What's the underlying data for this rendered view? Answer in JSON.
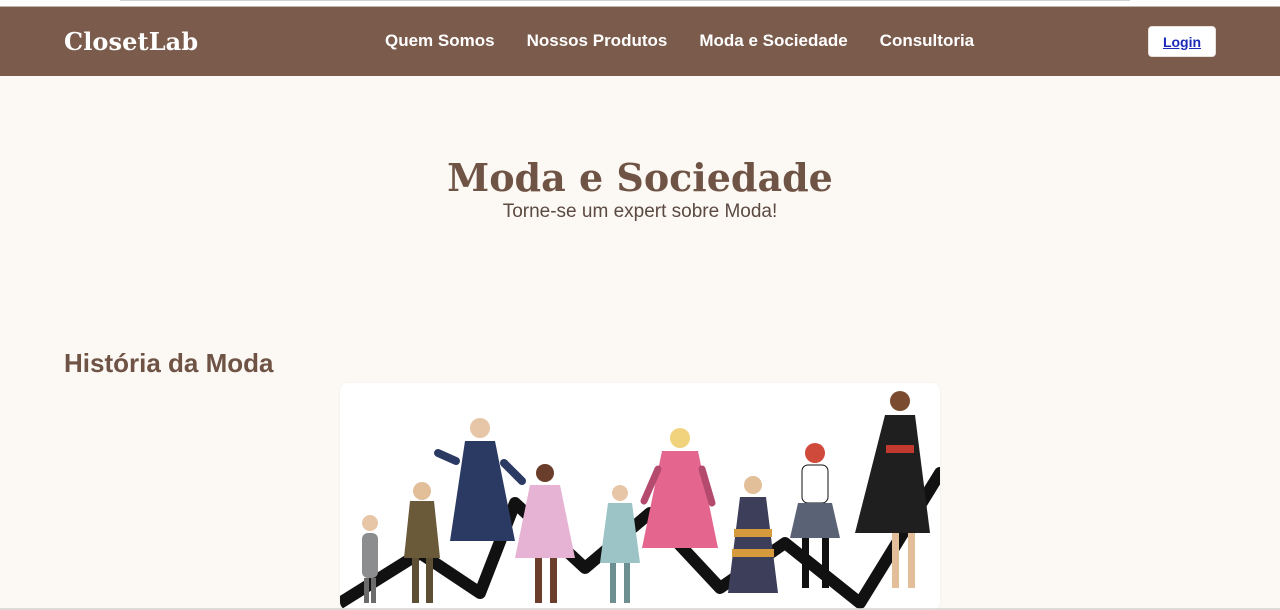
{
  "header": {
    "brand": "ClosetLab",
    "nav": [
      "Quem Somos",
      "Nossos Produtos",
      "Moda e Sociedade",
      "Consultoria"
    ],
    "login_label": "Login"
  },
  "hero": {
    "title": "Moda e Sociedade",
    "subtitle": "Torne-se um expert sobre Moda!"
  },
  "section": {
    "title": "História da Moda"
  },
  "colors": {
    "header_bg": "#7a5b4c",
    "page_bg": "#fcf8f4",
    "title_brown": "#6f5446",
    "link_blue": "#1b2bb8"
  },
  "illustration": {
    "icon_name": "fashion-history-illustration"
  }
}
